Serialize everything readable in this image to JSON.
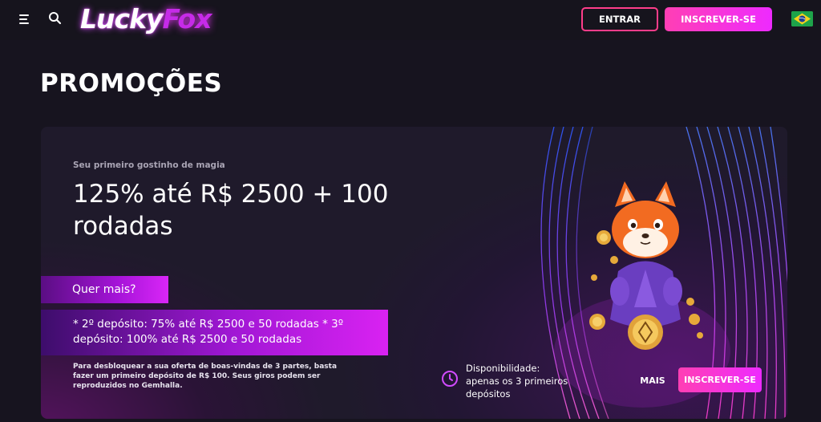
{
  "header": {
    "logo": {
      "part1": "Lucky",
      "part2": "Fox"
    },
    "login_label": "ENTRAR",
    "signup_label": "INSCREVER-SE",
    "icons": [
      "menu-icon",
      "search-icon",
      "brazil-flag-icon"
    ]
  },
  "page": {
    "title": "PROMOÇÕES"
  },
  "promo": {
    "subtitle": "Seu primeiro gostinho de magia",
    "headline": "125% até R$ 2500 + 100 rodadas",
    "more_band": "Quer mais?",
    "deposits_band": "* 2º depósito: 75% até R$ 2500 e 50 rodadas * 3º depósito: 100% até R$ 2500 e 50 rodadas",
    "fine_print": "Para desbloquear a sua oferta de boas-vindas de 3 partes, basta fazer um primeiro depósito de R$ 100. Seus giros podem ser reproduzidos no Gemhalla.",
    "availability_label": "Disponibilidade:",
    "availability_value": "apenas os 3 primeiros depósitos",
    "more_button": "MAIS",
    "signup_button": "INSCREVER-SE",
    "icons": [
      "clock-icon",
      "fox-mascot"
    ]
  },
  "colors": {
    "background": "#17141f",
    "accent_pink": "#ff3fb4",
    "accent_purple": "#ee2aff",
    "login_border": "#ff3d8a"
  }
}
